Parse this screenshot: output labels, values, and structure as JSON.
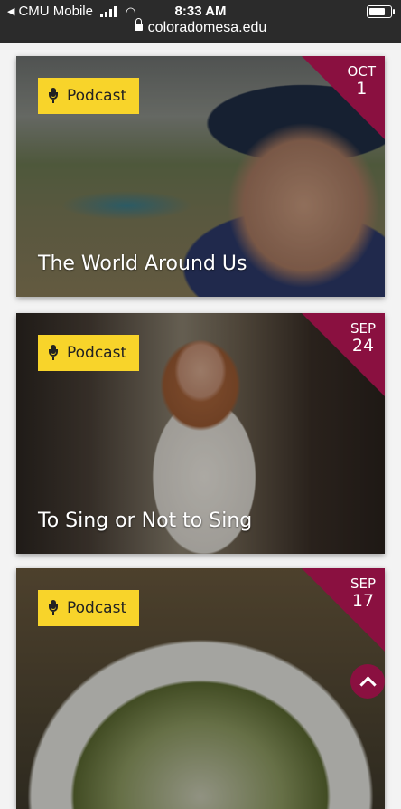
{
  "status_bar": {
    "carrier": "CMU Mobile",
    "time": "8:33 AM",
    "url": "coloradomesa.edu"
  },
  "cards": [
    {
      "badge": "Podcast",
      "month": "OCT",
      "day": "1",
      "title": "The World Around Us"
    },
    {
      "badge": "Podcast",
      "month": "SEP",
      "day": "24",
      "title": "To Sing or Not to Sing"
    },
    {
      "badge": "Podcast",
      "month": "SEP",
      "day": "17",
      "title": ""
    }
  ],
  "colors": {
    "accent": "#8a1040",
    "badge": "#f8d42a"
  },
  "icons": {
    "badge_icon": "microphone-icon",
    "back_to_top": "chevron-up-icon"
  }
}
